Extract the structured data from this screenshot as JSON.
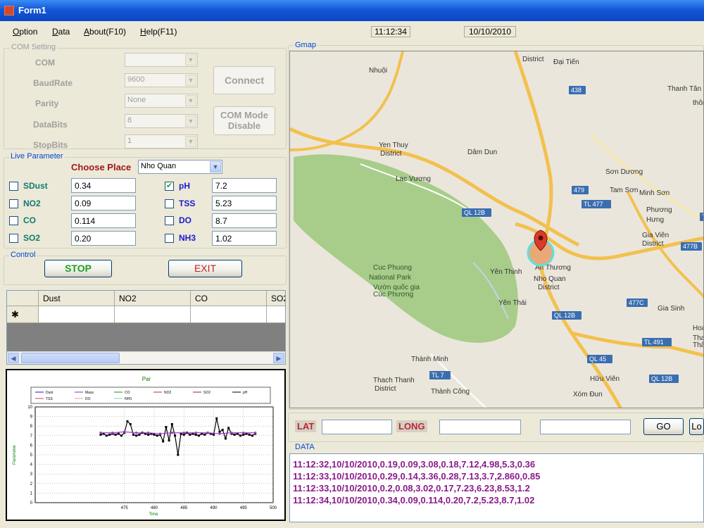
{
  "window": {
    "title": "Form1"
  },
  "menu": [
    "Option",
    "Data",
    "About(F10)",
    "Help(F11)"
  ],
  "clock": {
    "time": "11:12:34",
    "date": "10/10/2010"
  },
  "com_setting": {
    "group_title": "COM Setting",
    "labels": {
      "com": "COM",
      "baudrate": "BaudRate",
      "parity": "Parity",
      "databits": "DataBits",
      "stopbits": "StopBits"
    },
    "values": {
      "com": "",
      "baudrate": "9600",
      "parity": "None",
      "databits": "8",
      "stopbits": "1"
    },
    "connect_label": "Connect",
    "com_mode_label_1": "COM Mode",
    "com_mode_label_2": "Disable"
  },
  "live": {
    "group_title": "Live Parameter",
    "choose_place_label": "Choose Place",
    "place_value": "Nho Quan",
    "params": [
      {
        "label": "SDust",
        "value": "0.34",
        "checked": false,
        "color": "#117a71"
      },
      {
        "label": "NO2",
        "value": "0.09",
        "checked": false,
        "color": "#117a71"
      },
      {
        "label": "CO",
        "value": "0.114",
        "checked": false,
        "color": "#117a71"
      },
      {
        "label": "SO2",
        "value": "0.20",
        "checked": false,
        "color": "#117a71"
      },
      {
        "label": "pH",
        "value": "7.2",
        "checked": true,
        "color": "#1a1ad0"
      },
      {
        "label": "TSS",
        "value": "5.23",
        "checked": false,
        "color": "#1a1ad0"
      },
      {
        "label": "DO",
        "value": "8.7",
        "checked": false,
        "color": "#1a1ad0"
      },
      {
        "label": "NH3",
        "value": "1.02",
        "checked": false,
        "color": "#1a1ad0"
      }
    ]
  },
  "control": {
    "group_title": "Control",
    "stop_label": "STOP",
    "exit_label": "EXIT"
  },
  "grid": {
    "columns": [
      "Dust",
      "NO2",
      "CO",
      "SO2"
    ],
    "new_row_marker": "✱"
  },
  "chart_data": {
    "type": "line",
    "title": "Par",
    "xlabel": "Time",
    "ylabel": "Parameter",
    "xlim": [
      460,
      500
    ],
    "ylim": [
      0,
      10
    ],
    "x_ticks": [
      "475",
      "480",
      "485",
      "490",
      "495",
      "500"
    ],
    "y_ticks": [
      "0",
      "1",
      "2",
      "3",
      "4",
      "5",
      "6",
      "7",
      "8",
      "9",
      "10"
    ],
    "legend": [
      "Dust",
      "Mass",
      "CO",
      "NO2",
      "SO2",
      "pH",
      "TSS",
      "DO",
      "NH3"
    ],
    "series": [
      {
        "name": "pH",
        "color": "#000000",
        "x": [
          471,
          471.5,
          472,
          472.5,
          473,
          473.5,
          474,
          474.5,
          475,
          475.5,
          476,
          476.5,
          477,
          477.5,
          478,
          478.5,
          479,
          479.5,
          480,
          480.5,
          481,
          481.5,
          482,
          482.5,
          483,
          483.5,
          484,
          484.5,
          485,
          485.5,
          486,
          486.5,
          487,
          487.5,
          488,
          488.5,
          489,
          489.5,
          490,
          490.5,
          491,
          491.5,
          492,
          492.5,
          493,
          493.5,
          494,
          494.5,
          495,
          495.5,
          496,
          496.5,
          497
        ],
        "y": [
          7.1,
          7.2,
          7.0,
          7.1,
          7.2,
          7.1,
          7.2,
          7.0,
          7.3,
          8.5,
          8.2,
          7.1,
          7.0,
          7.1,
          7.3,
          7.2,
          7.1,
          7.2,
          7.1,
          7.0,
          7.1,
          6.4,
          7.9,
          6.5,
          8.2,
          7.0,
          5.0,
          7.2,
          7.1,
          7.3,
          7.1,
          7.2,
          7.1,
          7.0,
          7.2,
          7.1,
          7.3,
          7.2,
          7.1,
          8.8,
          7.4,
          7.6,
          6.7,
          7.8,
          7.2,
          7.1,
          7.2,
          7.0,
          7.1,
          7.2,
          7.1,
          7.0,
          7.2
        ]
      },
      {
        "name": "NH3",
        "color": "#a03ac8",
        "x": [
          471,
          473,
          475,
          477,
          479,
          481,
          483,
          485,
          487,
          489,
          491,
          493,
          495,
          497
        ],
        "y": [
          7.3,
          7.3,
          7.4,
          7.3,
          7.3,
          7.2,
          7.3,
          7.3,
          7.3,
          7.3,
          7.2,
          7.3,
          7.3,
          7.3
        ]
      }
    ]
  },
  "map": {
    "group_title": "Gmap",
    "labels": [
      {
        "t": "District"
      },
      {
        "t": "Đại Tiến"
      },
      {
        "t": "Nhuội"
      },
      {
        "t": "Thanh Tân"
      },
      {
        "t": "thôn"
      },
      {
        "t": "Yen Thuy"
      },
      {
        "t": "District"
      },
      {
        "t": "Dâm Dun"
      },
      {
        "t": "Lac Vương"
      },
      {
        "t": "Sơn Dương"
      },
      {
        "t": "Tam Sơn"
      },
      {
        "t": "Minh Sơn"
      },
      {
        "t": "Phương"
      },
      {
        "t": "Hưng"
      },
      {
        "t": "Gia Viên"
      },
      {
        "t": "District"
      },
      {
        "t": "Cuc Phuong"
      },
      {
        "t": "National Park"
      },
      {
        "t": "Vườn quốc gia"
      },
      {
        "t": "Cúc Phương"
      },
      {
        "t": "Yên Thịnh"
      },
      {
        "t": "An Thương"
      },
      {
        "t": "Nho Quan"
      },
      {
        "t": "District"
      },
      {
        "t": "Yên Thái"
      },
      {
        "t": "Gia Sinh"
      },
      {
        "t": "Thành Minh"
      },
      {
        "t": "Thach Thanh"
      },
      {
        "t": "District"
      },
      {
        "t": "Thành Công"
      },
      {
        "t": "Hữu Viên"
      },
      {
        "t": "Xóm Đun"
      },
      {
        "t": "Hoa"
      },
      {
        "t": "Thanh"
      },
      {
        "t": "Thất"
      }
    ],
    "shields": [
      "QL 12B",
      "TL 477",
      "QL 12B",
      "TL 491",
      "QL 45",
      "TL 7",
      "QL 12B",
      "479",
      "477B",
      "477C",
      "438",
      "TL"
    ]
  },
  "coords": {
    "lat_label": "LAT",
    "long_label": "LONG",
    "lat_value": "",
    "long_value": "",
    "extra_value": "",
    "go_label": "GO",
    "lo_label": "Lo"
  },
  "data_log": {
    "group_title": "DATA",
    "lines": [
      "11:12:32,10/10/2010,0.19,0.09,3.08,0.18,7.12,4.98,5.3,0.36",
      "11:12:33,10/10/2010,0.29,0.14,3.36,0.28,7.13,3.7,2.860,0.85",
      "11:12:33,10/10/2010,0.2,0.08,3.02,0.17,7.23,6.23,8.53,1.2",
      "11:12:34,10/10/2010,0.34,0.09,0.114,0.20,7.2,5.23,8.7,1.02"
    ]
  }
}
